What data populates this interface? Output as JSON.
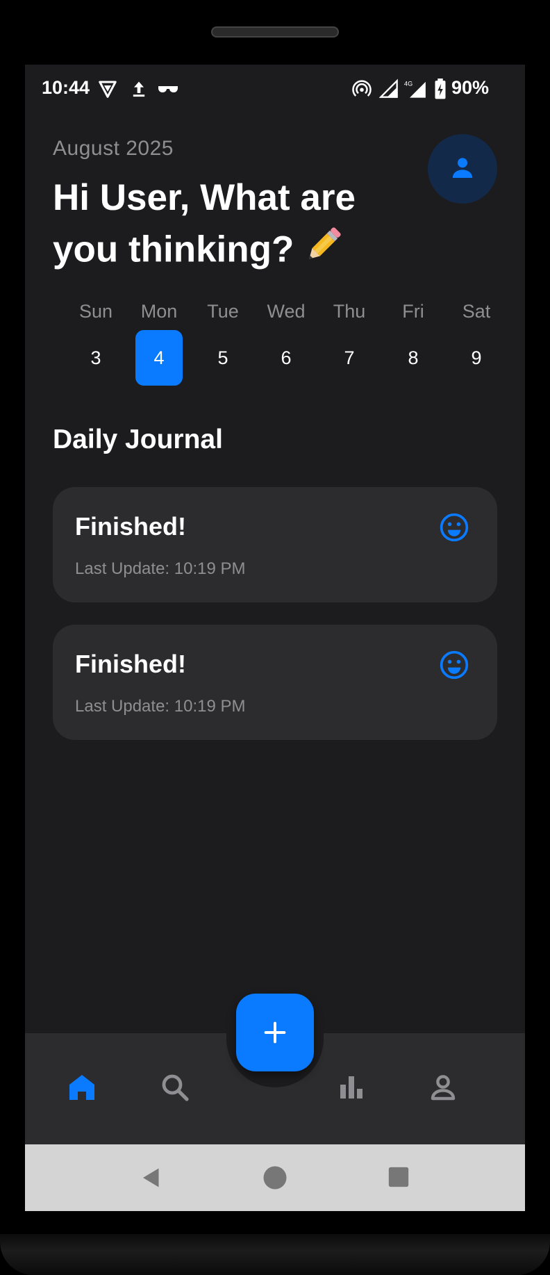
{
  "status_bar": {
    "time": "10:44",
    "battery": "90%",
    "icons": [
      "vpn-shield-icon",
      "upload-icon",
      "glasses-icon",
      "hotspot-icon",
      "signal-icon",
      "4g-signal-icon",
      "battery-charging-icon"
    ],
    "network_label": "4G"
  },
  "header": {
    "month": "August 2025",
    "greeting": "Hi User, What are you thinking?",
    "emoji": "✏️",
    "avatar_icon": "person-icon"
  },
  "week": {
    "days": [
      {
        "name": "Sun",
        "num": "3"
      },
      {
        "name": "Mon",
        "num": "4"
      },
      {
        "name": "Tue",
        "num": "5"
      },
      {
        "name": "Wed",
        "num": "6"
      },
      {
        "name": "Thu",
        "num": "7"
      },
      {
        "name": "Fri",
        "num": "8"
      },
      {
        "name": "Sat",
        "num": "9"
      }
    ],
    "selected_index": 1
  },
  "journal": {
    "title": "Daily Journal",
    "entries": [
      {
        "title": "Finished!",
        "subtitle": "Last Update: 10:19 PM",
        "mood_icon": "smile-icon"
      },
      {
        "title": "Finished!",
        "subtitle": "Last Update: 10:19 PM",
        "mood_icon": "smile-icon"
      }
    ]
  },
  "bottom_nav": {
    "items": [
      "home-icon",
      "search-icon",
      "stats-icon",
      "profile-icon"
    ],
    "active": "home-icon",
    "fab_icon": "plus-icon"
  },
  "system_nav": [
    "back-icon",
    "home-circle-icon",
    "recents-icon"
  ],
  "colors": {
    "accent": "#0a7aff",
    "background": "#1c1c1e",
    "card": "#2c2c2e",
    "muted_text": "#8e8e93",
    "inactive_icon": "#8e8e93"
  }
}
